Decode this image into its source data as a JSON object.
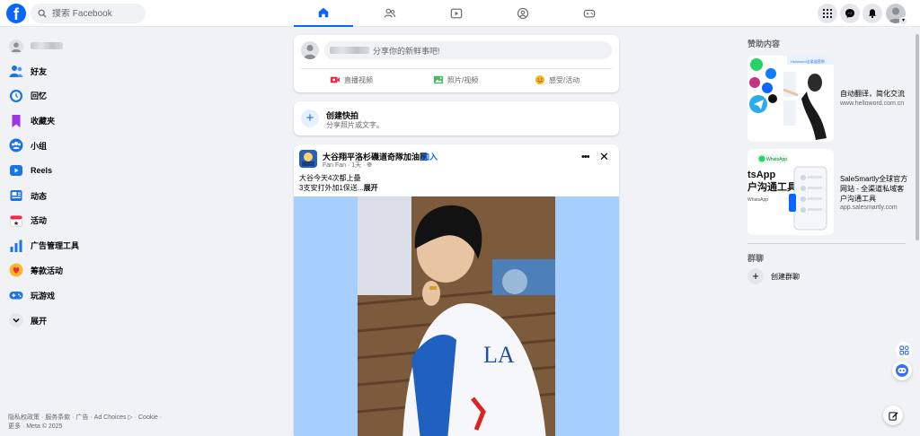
{
  "topbar": {
    "logo_letter": "f",
    "search_placeholder": "搜索 Facebook",
    "nav_tabs": [
      {
        "name": "home",
        "icon": "home-icon",
        "active": true
      },
      {
        "name": "friends",
        "icon": "friends-icon",
        "active": false
      },
      {
        "name": "video",
        "icon": "video-icon",
        "active": false
      },
      {
        "name": "groups",
        "icon": "groups-icon",
        "active": false
      },
      {
        "name": "gaming",
        "icon": "gaming-icon",
        "active": false
      }
    ],
    "right_buttons": [
      "menu-grid-icon",
      "messenger-icon",
      "bell-icon",
      "profile-avatar"
    ],
    "accent_color": "#0866ff"
  },
  "sidebar": {
    "items": [
      {
        "label": "好友",
        "icon": "friends-icon"
      },
      {
        "label": "回忆",
        "icon": "clock-icon"
      },
      {
        "label": "收藏夹",
        "icon": "bookmark-icon"
      },
      {
        "label": "小组",
        "icon": "groups-icon"
      },
      {
        "label": "Reels",
        "icon": "reels-icon"
      },
      {
        "label": "动态",
        "icon": "feed-icon"
      },
      {
        "label": "活动",
        "icon": "calendar-icon"
      },
      {
        "label": "广告管理工具",
        "icon": "ads-chart-icon"
      },
      {
        "label": "筹款活动",
        "icon": "fundraiser-heart-icon"
      },
      {
        "label": "玩游戏",
        "icon": "gamepad-icon"
      },
      {
        "label": "展开",
        "icon": "chevron-down-icon"
      }
    ],
    "footer": "隐私权政策 · 服务条款 · 广告 · Ad Choices ▷ · Cookie · 更多 · Meta © 2025"
  },
  "composer": {
    "prompt": "分享你的新鲜事吧!",
    "actions": [
      {
        "label": "直播视频",
        "icon": "live-video-icon"
      },
      {
        "label": "照片/视频",
        "icon": "photo-icon"
      },
      {
        "label": "感受/活动",
        "icon": "smiley-icon"
      }
    ]
  },
  "reel": {
    "title": "创建快拍",
    "subtitle": "分享照片或文字。"
  },
  "post": {
    "group_name": "大谷翔平洛杉磯道奇隊加油團",
    "join_label": "加入",
    "meta": "Fan Fan · 1天 · ",
    "line1": "大谷今天4次都上壘",
    "line2": "3支安打外加1保送...",
    "expand_label": "展开"
  },
  "right": {
    "sponsored_heading": "赞助内容",
    "ads": [
      {
        "title": "自动翻译，简化交流",
        "url": "www.helloword.com.cn"
      },
      {
        "title": "SaleSmartly全球官方网站 - 全渠道私域客户沟通工具",
        "url": "app.salesmartly.com"
      }
    ],
    "ad_image_text": {
      "top_banner": "Helloword全渠道营销",
      "whatsapp_badge": "WhatsApp",
      "big_line1": "tsApp",
      "big_line2": "户沟通工具",
      "small_line": "WhatsApp"
    },
    "group_chat_heading": "群聊",
    "create_group_label": "创建群聊"
  }
}
